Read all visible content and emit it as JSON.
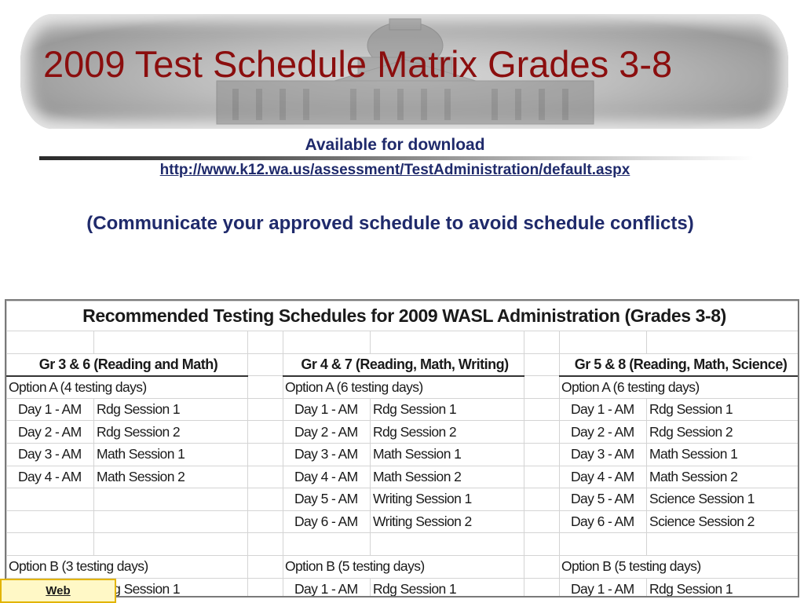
{
  "slide": {
    "title": "2009 Test Schedule Matrix Grades 3-8",
    "available": "Available for download",
    "link": "http://www.k12.wa.us/assessment/TestAdministration/default.aspx",
    "note": "(Communicate your approved schedule to avoid schedule conflicts)",
    "web_button": "Web"
  },
  "table": {
    "title": "Recommended Testing Schedules for 2009 WASL Administration (Grades 3-8)",
    "groups": [
      "Gr 3 & 6 (Reading and Math)",
      "Gr 4 & 7 (Reading, Math, Writing)",
      "Gr 5 & 8 (Reading, Math, Science)"
    ],
    "option_a": [
      "Option A (4 testing days)",
      "Option A (6 testing days)",
      "Option A (6 testing days)"
    ],
    "rows_a": [
      [
        "Day 1 - AM",
        "Rdg Session 1",
        "Day 1 - AM",
        "Rdg Session 1",
        "Day 1 - AM",
        "Rdg Session 1"
      ],
      [
        "Day 2 - AM",
        "Rdg Session 2",
        "Day 2 - AM",
        "Rdg Session 2",
        "Day 2 - AM",
        "Rdg Session 2"
      ],
      [
        "Day 3 - AM",
        "Math Session 1",
        "Day 3 - AM",
        "Math Session 1",
        "Day 3 - AM",
        "Math Session 1"
      ],
      [
        "Day 4 - AM",
        "Math Session 2",
        "Day 4 - AM",
        "Math Session 2",
        "Day 4 - AM",
        "Math Session 2"
      ],
      [
        "",
        "",
        "Day 5 - AM",
        "Writing Session 1",
        "Day 5 - AM",
        "Science Session 1"
      ],
      [
        "",
        "",
        "Day 6 - AM",
        "Writing Session 2",
        "Day 6 - AM",
        "Science Session 2"
      ]
    ],
    "option_b": [
      "Option B (3 testing days)",
      "Option B (5 testing days)",
      "Option B (5 testing days)"
    ],
    "rows_b": [
      [
        "",
        "Rdg Session 1",
        "Day 1 - AM",
        "Rdg Session 1",
        "Day 1 - AM",
        "Rdg Session 1"
      ]
    ]
  }
}
